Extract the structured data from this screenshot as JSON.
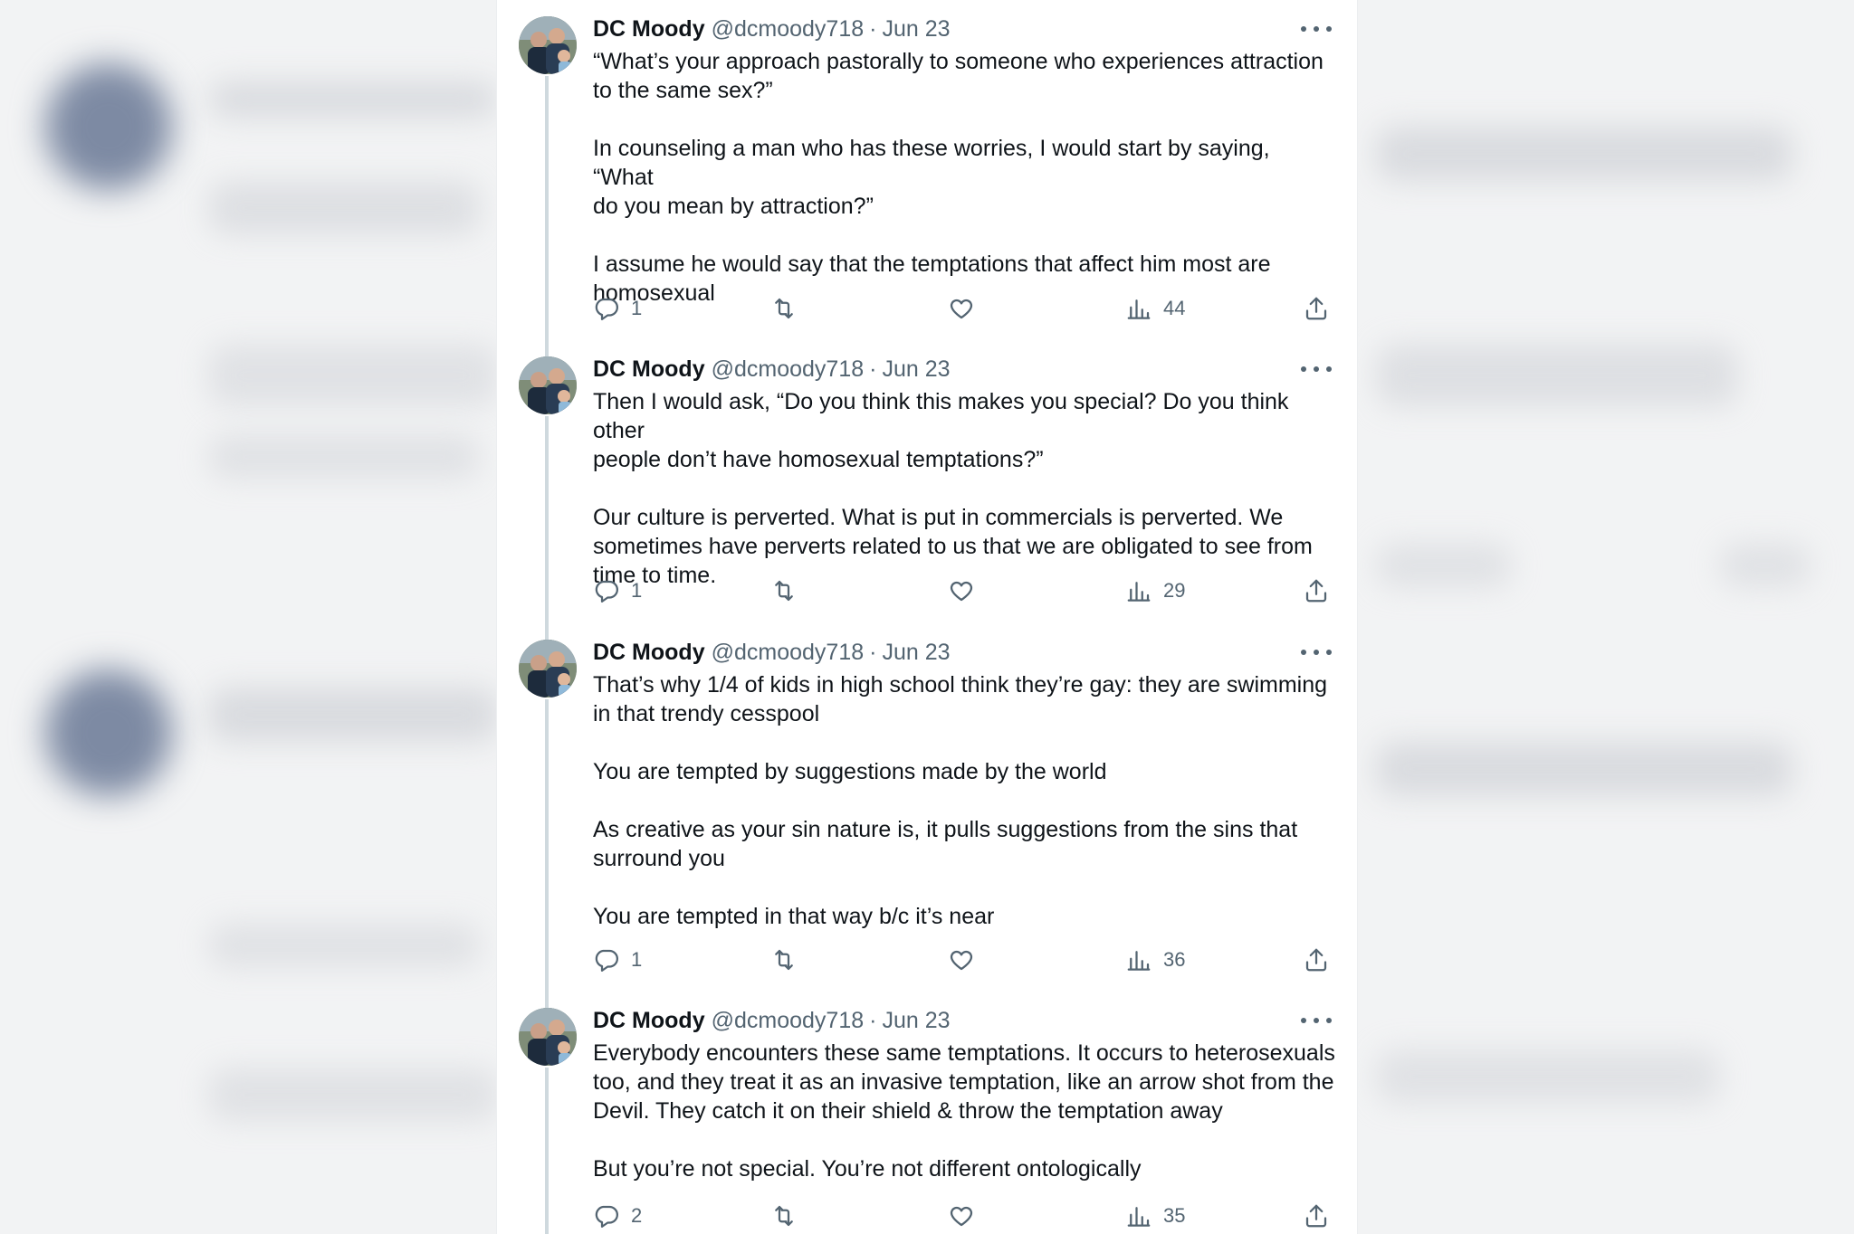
{
  "colors": {
    "text": "#0f1419",
    "muted": "#536471",
    "thread_line": "#cfd9de",
    "background": "#ffffff"
  },
  "tweets": [
    {
      "name": "DC Moody",
      "handle": "@dcmoody718",
      "separator": "·",
      "date": "Jun 23",
      "text": "“What’s your approach pastorally to someone who experiences attraction\nto the same sex?”\n\nIn counseling a man who has these worries, I would start by saying, “What\ndo you mean by attraction?”\n\nI assume he would say that the temptations that affect him most are\nhomosexual",
      "replies": "1",
      "reposts": "",
      "likes": "",
      "views": "44"
    },
    {
      "name": "DC Moody",
      "handle": "@dcmoody718",
      "separator": "·",
      "date": "Jun 23",
      "text": "Then I would ask, “Do you think this makes you special? Do you think other\npeople don’t have homosexual temptations?”\n\nOur culture is perverted. What is put in commercials is perverted. We\nsometimes have perverts related to us that we are obligated to see from\ntime to time.",
      "replies": "1",
      "reposts": "",
      "likes": "",
      "views": "29"
    },
    {
      "name": "DC Moody",
      "handle": "@dcmoody718",
      "separator": "·",
      "date": "Jun 23",
      "text": "That’s why 1/4 of kids in high school think they’re gay: they are swimming\nin that trendy cesspool\n\nYou are tempted by suggestions made by the world\n\nAs creative as your sin nature is, it pulls suggestions from the sins that\nsurround you\n\nYou are tempted in that way b/c it’s near",
      "replies": "1",
      "reposts": "",
      "likes": "",
      "views": "36"
    },
    {
      "name": "DC Moody",
      "handle": "@dcmoody718",
      "separator": "·",
      "date": "Jun 23",
      "text": "Everybody encounters these same temptations. It occurs to heterosexuals\ntoo, and they treat it as an invasive temptation, like an arrow shot from the\nDevil. They catch it on their shield & throw the temptation away\n\nBut you’re not special. You’re not different ontologically",
      "replies": "2",
      "reposts": "",
      "likes": "",
      "views": "35"
    }
  ]
}
